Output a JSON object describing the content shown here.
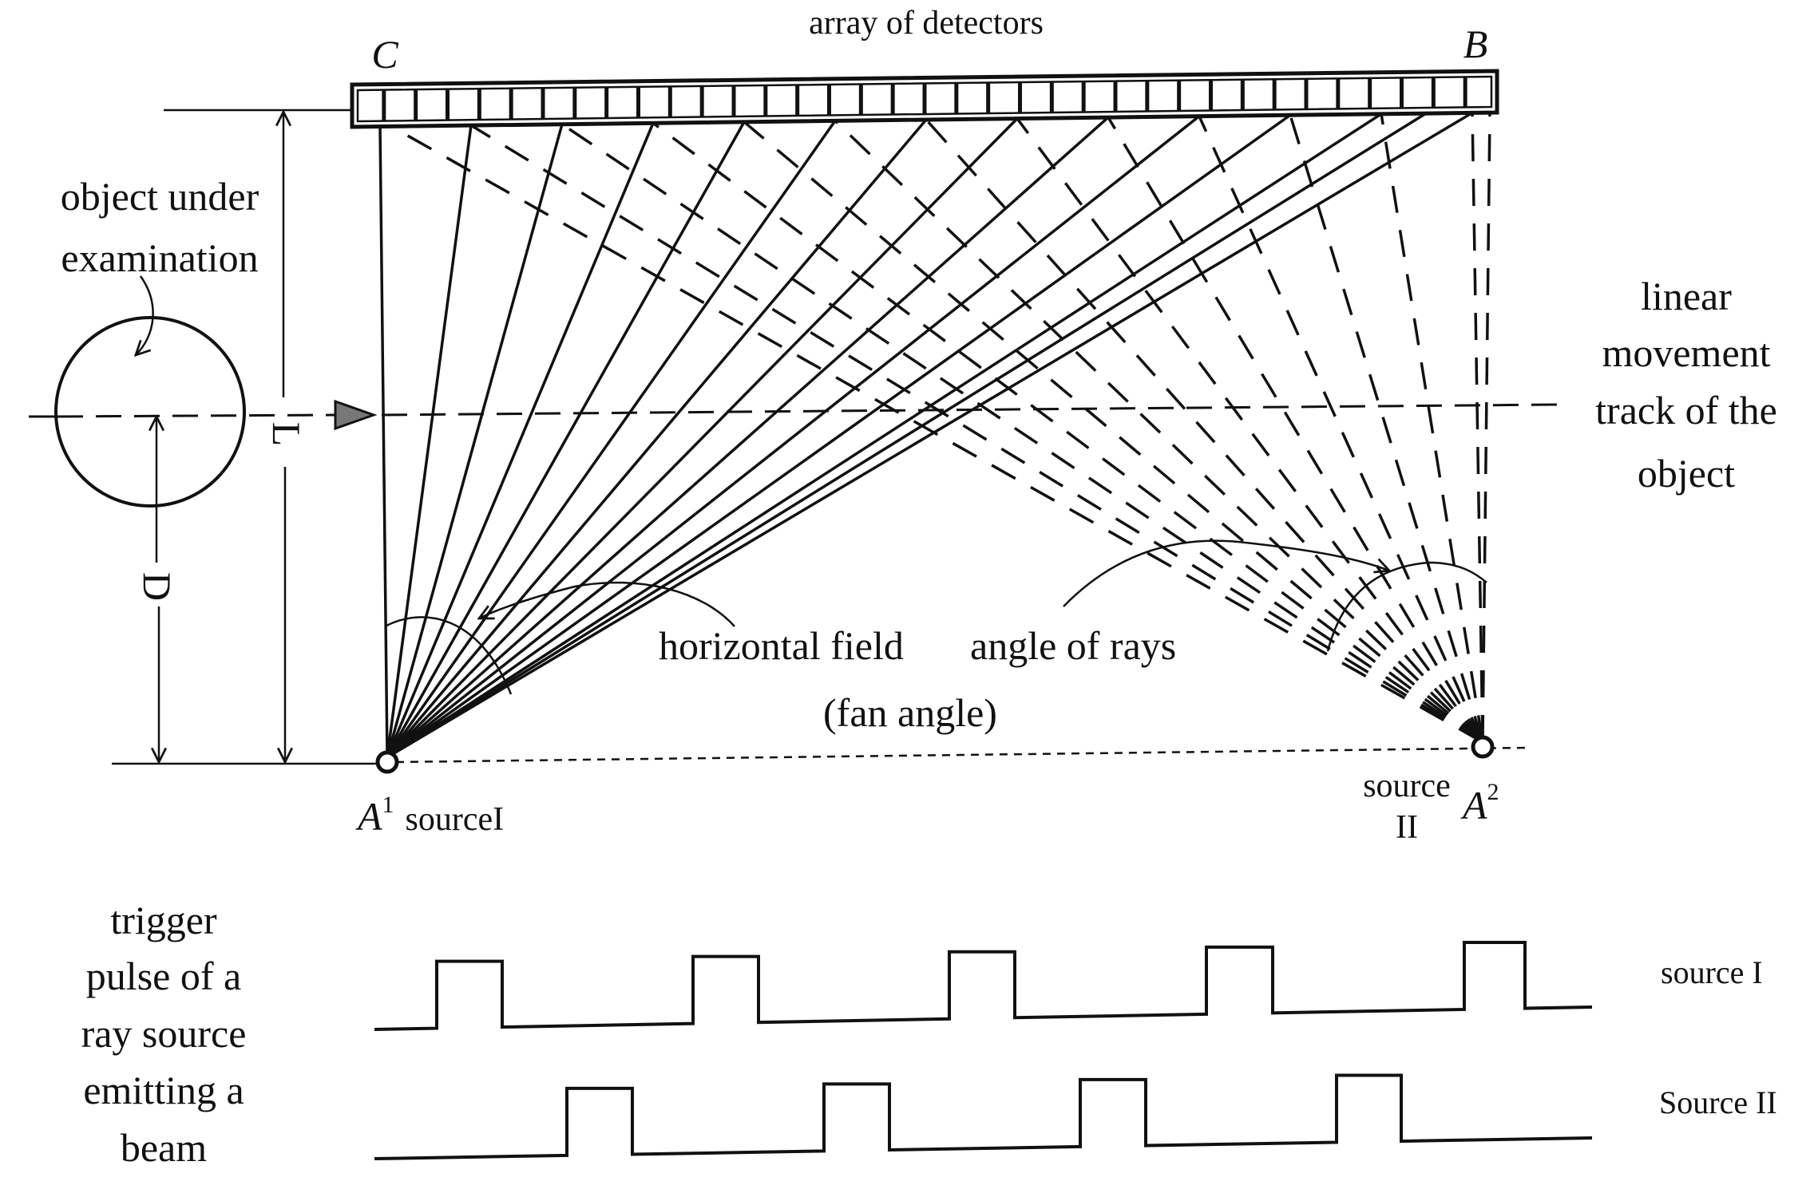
{
  "figure": {
    "title": "array of detectors",
    "corner_labels": {
      "left": "C",
      "right": "B"
    },
    "object_label": [
      "object under",
      "examination"
    ],
    "track_label": [
      "linear",
      "movement",
      "track of the",
      "object"
    ],
    "dimension_labels": {
      "outer": "L",
      "inner": "D"
    },
    "fan_labels": {
      "line1_left": "horizontal field",
      "line1_right": "angle of rays",
      "line2": "(fan angle)"
    },
    "source1": {
      "symbol": "A",
      "superscript": "1",
      "label": "sourceI"
    },
    "source2": {
      "symbol": "A",
      "superscript": "2",
      "label_line1": "source",
      "label_line2": "II"
    },
    "detector_count": 36,
    "ray_targets_count": 13
  },
  "timing": {
    "caption": [
      "trigger",
      "pulse of a",
      "ray source",
      "emitting a",
      "beam"
    ],
    "traces": [
      {
        "name": "source I",
        "pulse_count": 5
      },
      {
        "name": "Source II",
        "pulse_count": 4
      }
    ]
  }
}
